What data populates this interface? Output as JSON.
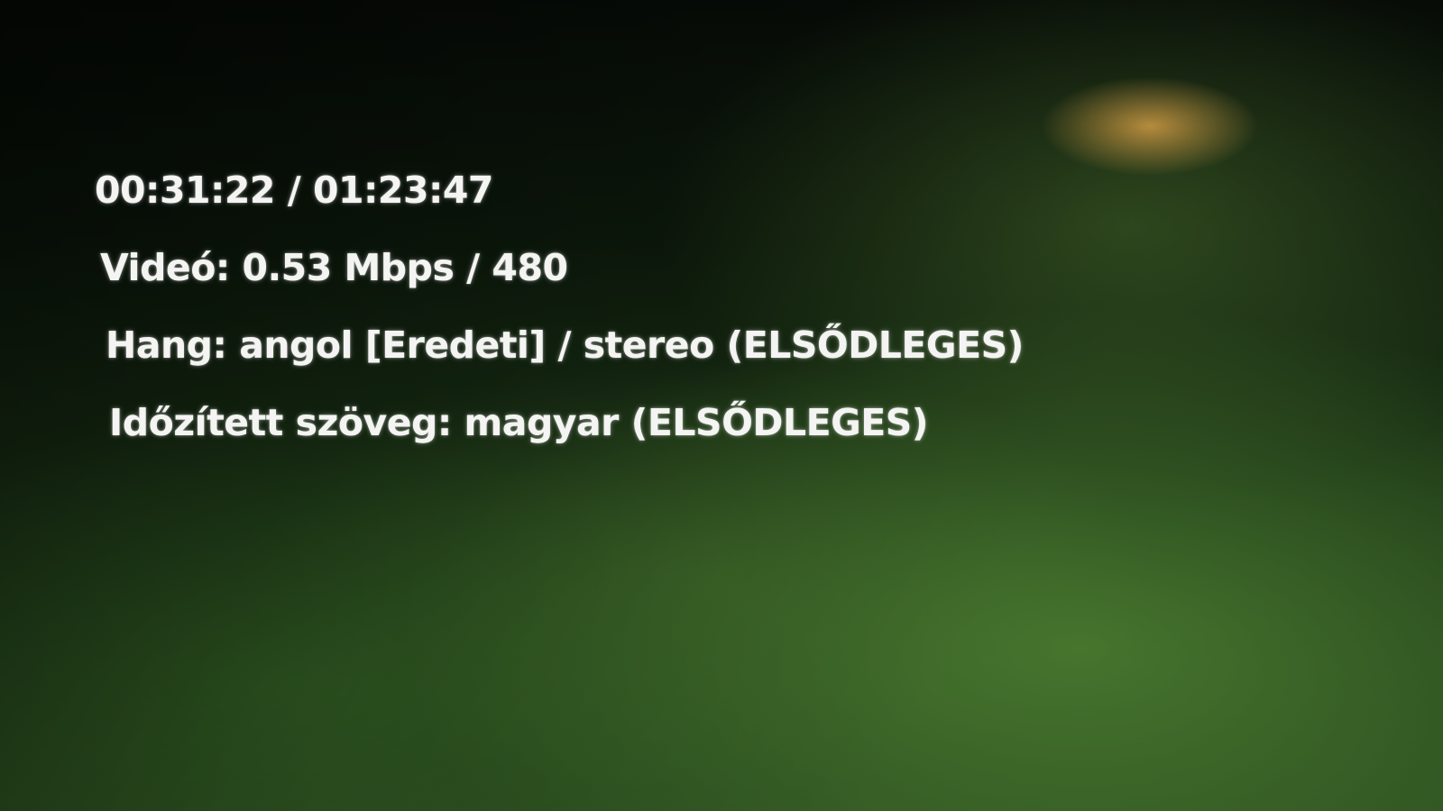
{
  "playback": {
    "time_readout": "00:31:22 / 01:23:47"
  },
  "stream_info": {
    "video": "Videó: 0.53 Mbps / 480",
    "audio": "Hang: angol [Eredeti] / stereo (ELSŐDLEGES)",
    "subtitles": "Időzített szöveg: magyar (ELSŐDLEGES)"
  }
}
